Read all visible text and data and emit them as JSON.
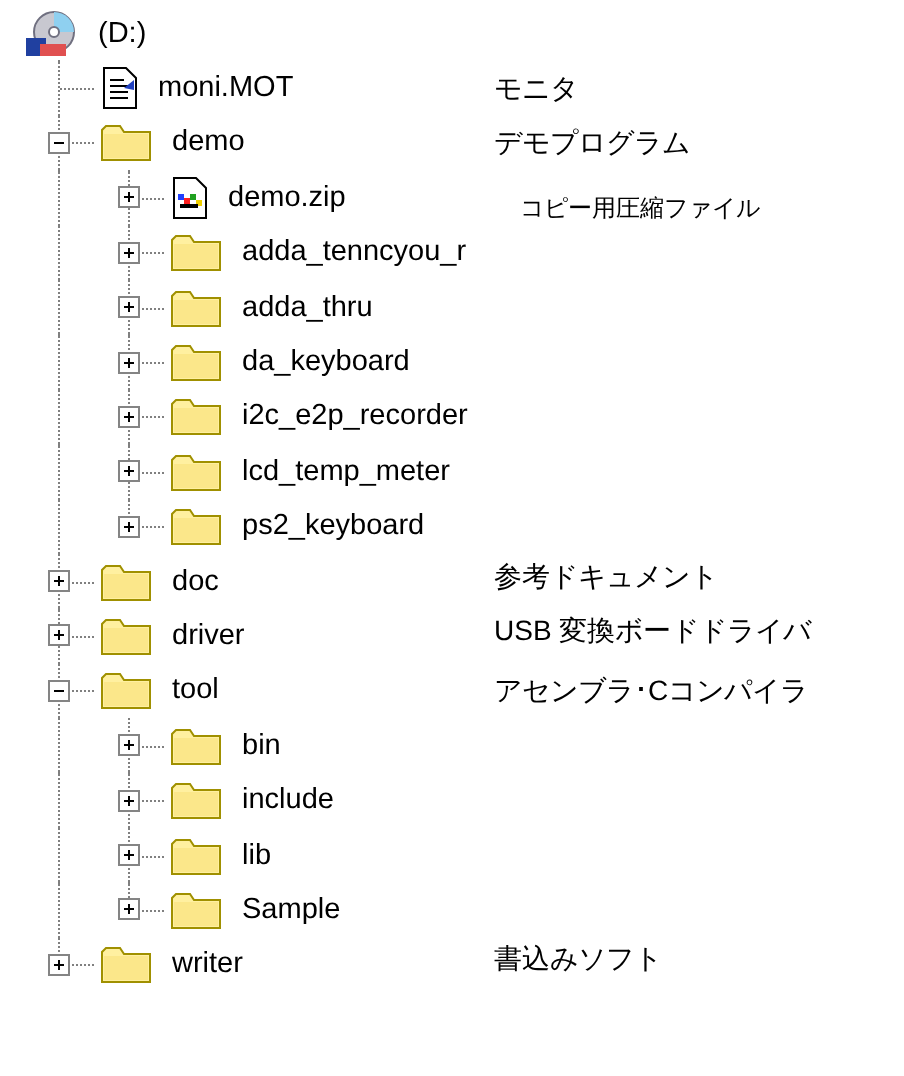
{
  "tree": {
    "label": "(D:)",
    "kind": "drive",
    "children": [
      {
        "label": "moni.MOT",
        "kind": "file",
        "note": "モニタ"
      },
      {
        "label": "demo",
        "kind": "folder",
        "expanded": true,
        "note": "デモプログラム",
        "children": [
          {
            "label": "demo.zip",
            "kind": "zip",
            "expanded": false,
            "note": "コピー用圧縮ファイル"
          },
          {
            "label": "adda_tenncyou_r",
            "kind": "folder",
            "expanded": false
          },
          {
            "label": "adda_thru",
            "kind": "folder",
            "expanded": false
          },
          {
            "label": "da_keyboard",
            "kind": "folder",
            "expanded": false
          },
          {
            "label": "i2c_e2p_recorder",
            "kind": "folder",
            "expanded": false
          },
          {
            "label": "lcd_temp_meter",
            "kind": "folder",
            "expanded": false
          },
          {
            "label": "ps2_keyboard",
            "kind": "folder",
            "expanded": false
          }
        ]
      },
      {
        "label": "doc",
        "kind": "folder",
        "expanded": false,
        "note": "参考ドキュメント"
      },
      {
        "label": "driver",
        "kind": "folder",
        "expanded": false,
        "note": "USB 変換ボードドライバ"
      },
      {
        "label": "tool",
        "kind": "folder",
        "expanded": true,
        "note": "アセンブラ･Cコンパイラ",
        "children": [
          {
            "label": "bin",
            "kind": "folder",
            "expanded": false
          },
          {
            "label": "include",
            "kind": "folder",
            "expanded": false
          },
          {
            "label": "lib",
            "kind": "folder",
            "expanded": false
          },
          {
            "label": "Sample",
            "kind": "folder",
            "expanded": false
          }
        ]
      },
      {
        "label": "writer",
        "kind": "folder",
        "expanded": false,
        "note": "書込みソフト"
      }
    ]
  }
}
